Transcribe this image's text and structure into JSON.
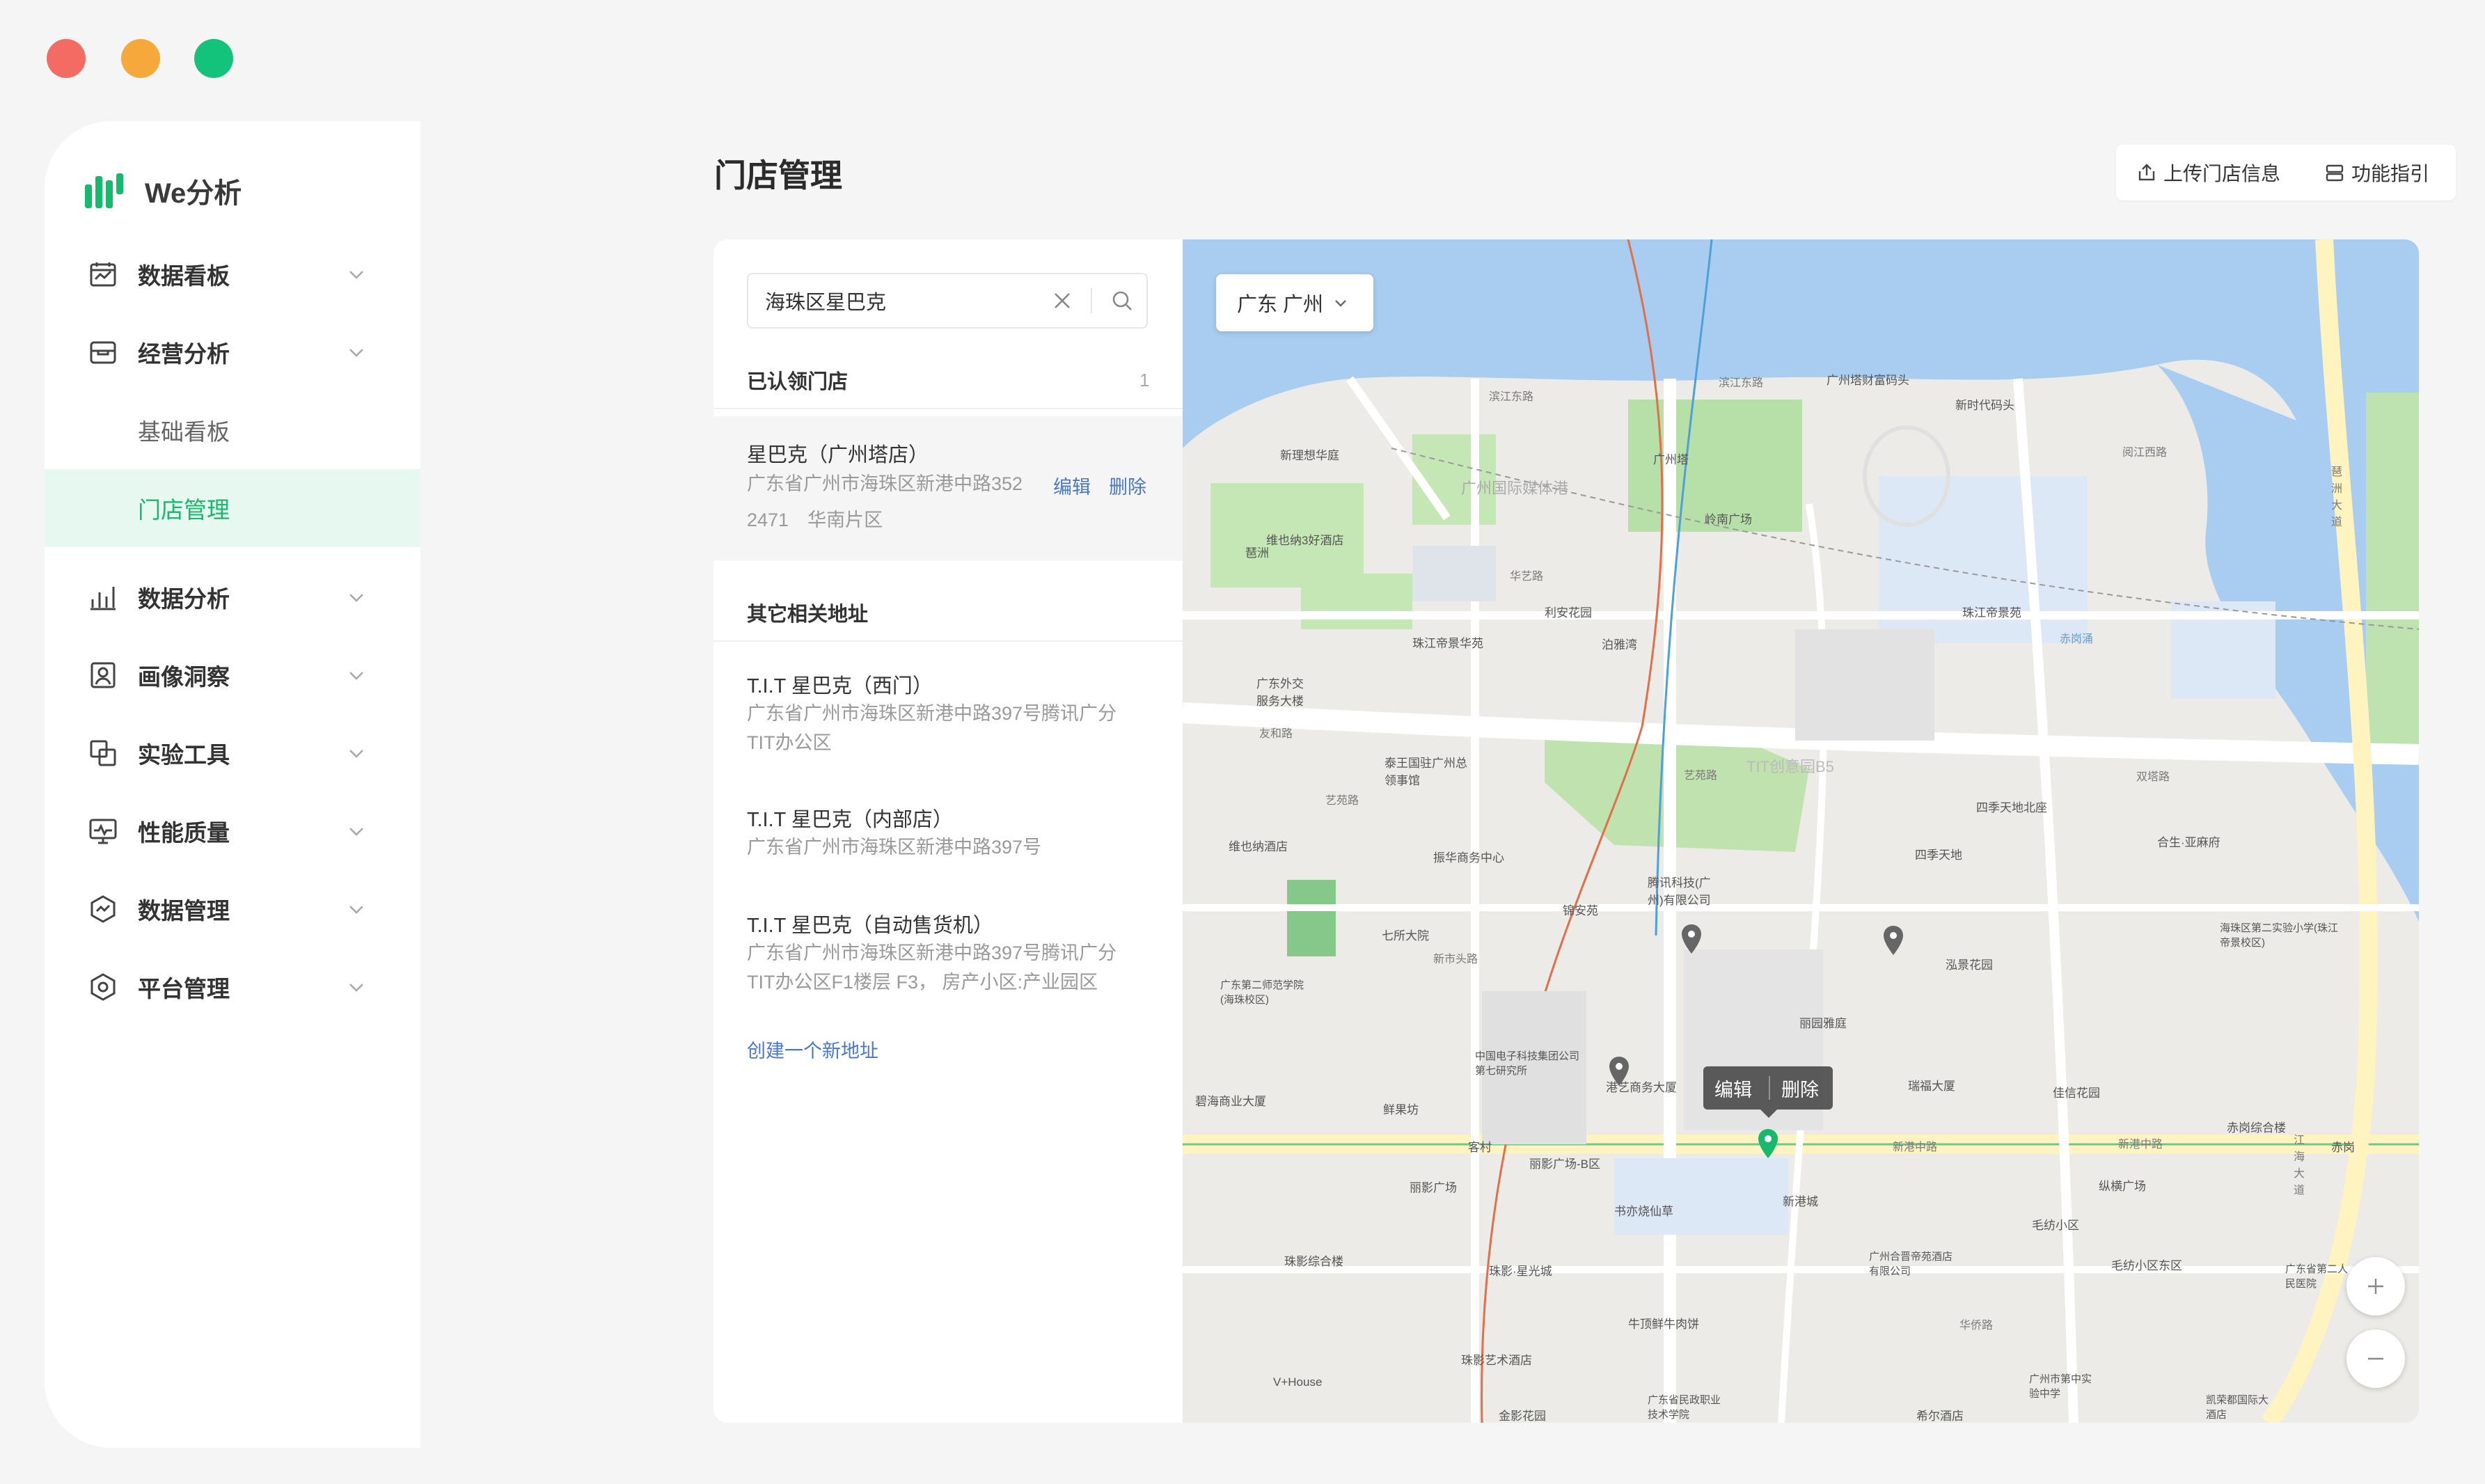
{
  "app": {
    "name": "We分析",
    "accent": "#17b96d"
  },
  "page": {
    "title": "门店管理"
  },
  "top_actions": {
    "upload": "上传门店信息",
    "guide": "功能指引"
  },
  "sidebar": {
    "items": [
      {
        "label": "数据看板",
        "icon": "dashboard-icon",
        "expandable": true
      },
      {
        "label": "经营分析",
        "icon": "store-icon",
        "expandable": true,
        "expanded": true
      },
      {
        "label": "基础看板",
        "sub": true
      },
      {
        "label": "门店管理",
        "sub": true,
        "active": true
      },
      {
        "label": "数据分析",
        "icon": "bar-chart-icon",
        "expandable": true
      },
      {
        "label": "画像洞察",
        "icon": "portrait-icon",
        "expandable": true
      },
      {
        "label": "实验工具",
        "icon": "experiment-icon",
        "expandable": true
      },
      {
        "label": "性能质量",
        "icon": "monitor-icon",
        "expandable": true
      },
      {
        "label": "数据管理",
        "icon": "data-manage-icon",
        "expandable": true
      },
      {
        "label": "平台管理",
        "icon": "platform-icon",
        "expandable": true
      }
    ]
  },
  "search": {
    "value": "海珠区星巴克"
  },
  "claimed": {
    "header": "已认领门店",
    "count": "1",
    "stores": [
      {
        "name": "星巴克（广州塔店）",
        "address_line1": "广东省广州市海珠区新港中路352",
        "address_line2": "2471　华南片区",
        "edit": "编辑",
        "delete": "删除"
      }
    ]
  },
  "other": {
    "header": "其它相关地址",
    "stores": [
      {
        "name": "T.I.T 星巴克（西门）",
        "address_line1": "广东省广州市海珠区新港中路397号腾讯广分",
        "address_line2": "TIT办公区"
      },
      {
        "name": "T.I.T 星巴克（内部店）",
        "address_line1": "广东省广州市海珠区新港中路397号",
        "address_line2": ""
      },
      {
        "name": "T.I.T 星巴克（自动售货机）",
        "address_line1": "广东省广州市海珠区新港中路397号腾讯广分",
        "address_line2": "TIT办公区F1楼层 F3， 房产小区:产业园区"
      }
    ],
    "create": "创建一个新地址"
  },
  "map": {
    "city": "广东 广州",
    "popup": {
      "edit": "编辑",
      "delete": "删除"
    },
    "labels": [
      "滨江东路",
      "滨江东路",
      "广州塔财富码头",
      "新时代码头",
      "阅江西路",
      "新理想华庭",
      "广州国际媒体港",
      "广州塔",
      "岭南广场",
      "维也纳3好酒店",
      "华艺路",
      "珠江帝景华苑",
      "利安花园",
      "泊雅湾",
      "珠江帝景苑",
      "赤岗涌",
      "广东外交服务大楼",
      "友和路",
      "泰王国驻广州总领事馆",
      "艺苑路",
      "艺苑路",
      "TIT创意园B5",
      "四季天地北座",
      "双塔路",
      "琶洲大道",
      "合生·亚麻府",
      "四季天地",
      "琶洲",
      "维也纳酒店",
      "振华商务中心",
      "腾讯科技(广州)有限公司",
      "锦安苑",
      "七所大院",
      "新市头路",
      "泓景花园",
      "海珠区第二实验小学(珠江帝景校区)",
      "广东第二师范学院(海珠校区)",
      "丽园雅庭",
      "中国电子科技集团公司第七研究所",
      "港艺商务大厦",
      "瑞福大厦",
      "佳信花园",
      "赤岗综合楼",
      "赤岗",
      "碧海商业大厦",
      "鲜果坊",
      "客村",
      "丽影广场-B区",
      "新港中路",
      "新港城",
      "丽影广场",
      "纵横广场",
      "书亦烧仙草",
      "毛纺小区",
      "毛纺小区东区",
      "珠影综合楼",
      "珠影·星光城",
      "广州合晋帝苑酒店有限公司",
      "广东省第二人民医院",
      "牛顶鲜牛肉饼",
      "华侨路",
      "珠影艺术酒店",
      "V+House",
      "广东省民政职业技术学院",
      "广州市第中实验中学",
      "凯荣都国际大酒店",
      "金影花园",
      "希尔酒店",
      "江海大道",
      "新港中路"
    ]
  }
}
